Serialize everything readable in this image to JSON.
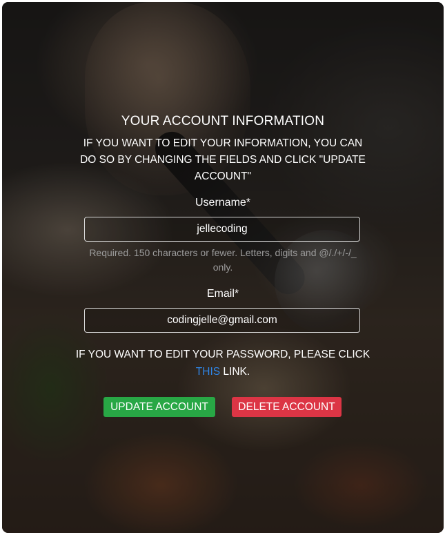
{
  "form": {
    "title": "YOUR ACCOUNT INFORMATION",
    "intro": "IF YOU WANT TO EDIT YOUR INFORMATION, YOU CAN DO SO BY CHANGING THE FIELDS AND CLICK \"UPDATE ACCOUNT\"",
    "username_label": "Username*",
    "username_value": "jellecoding",
    "username_help": "Required. 150 characters or fewer. Letters, digits and @/./+/-/_ only.",
    "email_label": "Email*",
    "email_value": "codingjelle@gmail.com",
    "password_note_prefix": "IF YOU WANT TO EDIT YOUR PASSWORD, PLEASE CLICK ",
    "password_link_text": "THIS",
    "password_note_suffix": " LINK.",
    "update_button": "UPDATE ACCOUNT",
    "delete_button": "DELETE ACCOUNT"
  },
  "colors": {
    "update_button": "#28a745",
    "delete_button": "#dc3545",
    "link": "#2f86e8",
    "help_text": "#9c9c9c"
  }
}
